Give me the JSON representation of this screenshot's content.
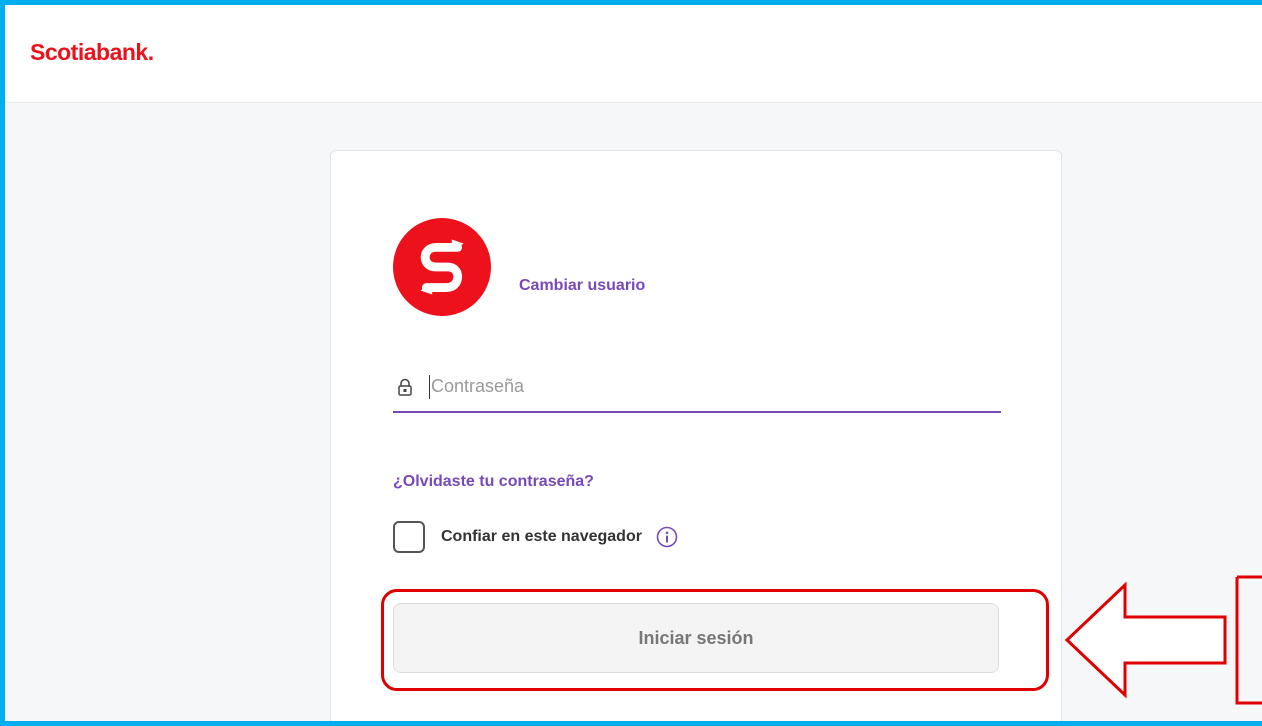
{
  "header": {
    "brand": "Scotiabank",
    "brand_dot": "."
  },
  "login": {
    "change_user_label": "Cambiar usuario",
    "password_placeholder": "Contraseña",
    "password_value": "",
    "forgot_password_label": "¿Olvidaste tu contraseña?",
    "trust_browser_label": "Confiar en este navegador",
    "trust_browser_checked": false,
    "submit_label": "Iniciar sesión"
  },
  "icons": {
    "avatar": "scotiabank-logo-icon",
    "password": "lock-icon",
    "trust_info": "info-icon"
  },
  "colors": {
    "brand_red": "#ec111a",
    "accent_purple": "#7849b8",
    "frame_blue": "#00aeef",
    "annotation_red": "#e00000"
  }
}
